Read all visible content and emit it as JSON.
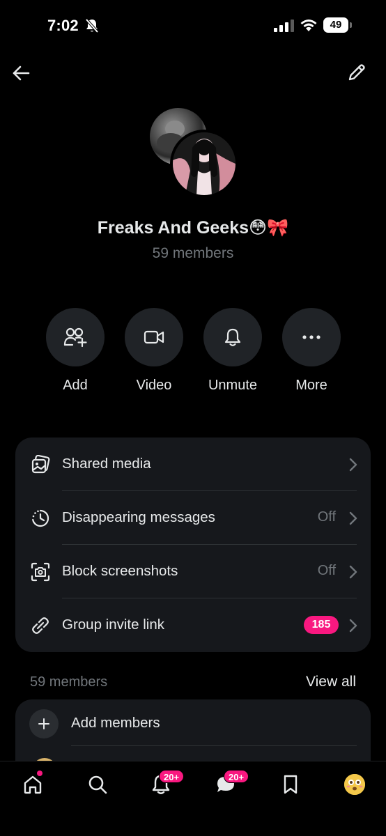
{
  "status_bar": {
    "time": "7:02",
    "battery": "49"
  },
  "group": {
    "title": "Freaks And Geeks😳🎀",
    "members_count": "59 members"
  },
  "actions": [
    {
      "label": "Add",
      "icon": "add-people-icon"
    },
    {
      "label": "Video",
      "icon": "video-camera-icon"
    },
    {
      "label": "Unmute",
      "icon": "bell-icon"
    },
    {
      "label": "More",
      "icon": "more-dots-icon"
    }
  ],
  "settings": [
    {
      "label": "Shared media",
      "value": "",
      "icon": "gallery-icon"
    },
    {
      "label": "Disappearing messages",
      "value": "Off",
      "icon": "clock-timer-icon"
    },
    {
      "label": "Block screenshots",
      "value": "Off",
      "icon": "screenshot-camera-icon"
    },
    {
      "label": "Group invite link",
      "badge": "185",
      "icon": "link-icon"
    }
  ],
  "members_section": {
    "header": "59 members",
    "view_all": "View all",
    "add_members": "Add members"
  },
  "bottom_nav": {
    "notifications_badge": "20+",
    "messages_badge": "20+"
  },
  "colors": {
    "background": "#000000",
    "card": "#16181c",
    "action_circle": "#202327",
    "text_primary": "#e7e9ea",
    "text_secondary": "#71767b",
    "badge": "#f91880"
  }
}
